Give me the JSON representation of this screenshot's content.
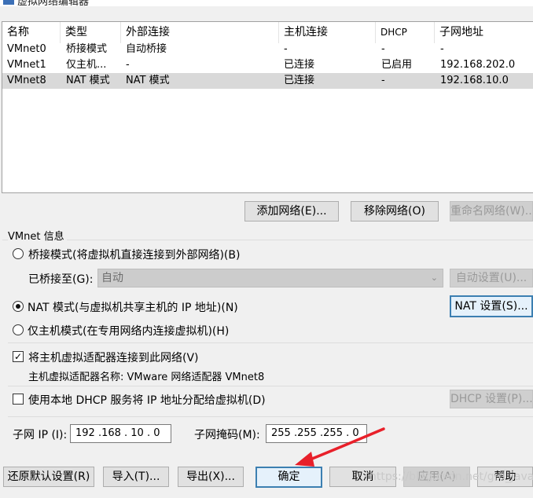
{
  "window": {
    "title": "虚拟网络编辑器"
  },
  "table": {
    "headers": [
      "名称",
      "类型",
      "外部连接",
      "主机连接",
      "DHCP",
      "子网地址"
    ],
    "rows": [
      [
        "VMnet0",
        "桥接模式",
        "自动桥接",
        "-",
        "-",
        "-"
      ],
      [
        "VMnet1",
        "仅主机...",
        "-",
        "已连接",
        "已启用",
        "192.168.202.0"
      ],
      [
        "VMnet8",
        "NAT 模式",
        "NAT 模式",
        "已连接",
        "-",
        "192.168.10.0"
      ]
    ],
    "selected_row": 2
  },
  "network_buttons": {
    "add": "添加网络(E)...",
    "remove": "移除网络(O)",
    "rename": "重命名网络(W)..."
  },
  "vmnet_info": {
    "group_label": "VMnet 信息",
    "bridged_radio": "桥接模式(将虚拟机直接连接到外部网络)(B)",
    "bridged_to_label": "已桥接至(G):",
    "bridged_to_value": "自动",
    "auto_settings_button": "自动设置(U)...",
    "nat_radio": "NAT 模式(与虚拟机共享主机的 IP 地址)(N)",
    "nat_settings_button": "NAT 设置(S)...",
    "hostonly_radio": "仅主机模式(在专用网络内连接虚拟机)(H)",
    "selected_mode": "nat",
    "connect_adapter_checkbox": "将主机虚拟适配器连接到此网络(V)",
    "connect_adapter_checked": true,
    "adapter_name_text": "主机虚拟适配器名称: VMware 网络适配器 VMnet8",
    "dhcp_checkbox": "使用本地 DHCP 服务将 IP 地址分配给虚拟机(D)",
    "dhcp_checked": false,
    "dhcp_settings_button": "DHCP 设置(P)...",
    "subnet_ip_label": "子网 IP (I):",
    "subnet_ip_value": "192 .168 . 10  .  0",
    "subnet_mask_label": "子网掩码(M):",
    "subnet_mask_value": "255 .255 .255 .  0"
  },
  "footer": {
    "restore_defaults": "还原默认设置(R)",
    "import": "导入(T)...",
    "export": "导出(X)...",
    "ok": "确定",
    "cancel": "取消",
    "apply": "应用(A)",
    "help": "帮助"
  },
  "watermark": "https://blog.csdn.net/grd_java",
  "colors": {
    "arrow": "#e8202a",
    "selected_row": "#d9d9d9",
    "focus_border": "#3c7fb1"
  }
}
